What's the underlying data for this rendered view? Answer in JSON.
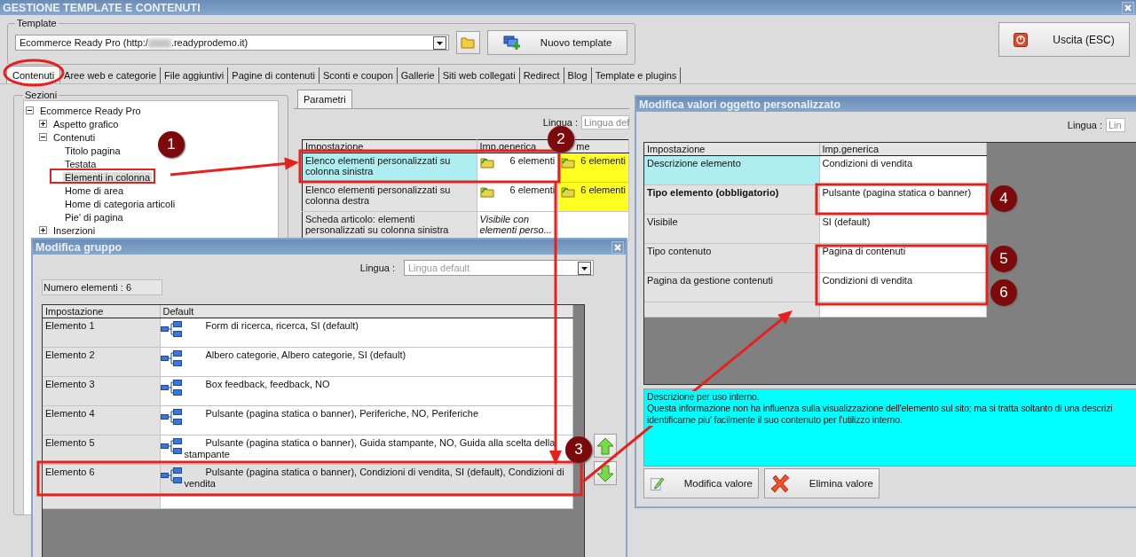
{
  "window": {
    "title": "GESTIONE TEMPLATE E CONTENUTI"
  },
  "template": {
    "label": "Template",
    "value_prefix": "Ecommerce Ready Pro (http:/",
    "value_suffix": ".readyprodemo.it)"
  },
  "buttons": {
    "new_template": "Nuovo template",
    "exit": "Uscita (ESC)"
  },
  "tabs": [
    {
      "label": "Contenuti",
      "selected": true
    },
    {
      "label": "Aree web e categorie",
      "selected": false
    },
    {
      "label": "File aggiuntivi",
      "selected": false
    },
    {
      "label": "Pagine di contenuti",
      "selected": false
    },
    {
      "label": "Sconti e coupon",
      "selected": false
    },
    {
      "label": "Gallerie",
      "selected": false
    },
    {
      "label": "Siti web collegati",
      "selected": false
    },
    {
      "label": "Redirect",
      "selected": false
    },
    {
      "label": "Blog",
      "selected": false
    },
    {
      "label": "Template e plugins",
      "selected": false
    }
  ],
  "sections": {
    "title": "Sezioni",
    "tree": [
      {
        "label": "Ecommerce Ready Pro",
        "expanded": true,
        "selected": false,
        "children": [
          {
            "label": "Aspetto grafico",
            "expanded": false,
            "selected": false
          },
          {
            "label": "Contenuti",
            "expanded": true,
            "selected": false,
            "children": [
              {
                "label": "Titolo pagina",
                "selected": false
              },
              {
                "label": "Testata",
                "selected": false
              },
              {
                "label": "Elementi in colonna",
                "selected": true
              },
              {
                "label": "Home di area",
                "selected": false
              },
              {
                "label": "Home di categoria articoli",
                "selected": false
              },
              {
                "label": "Pie' di pagina",
                "selected": false
              }
            ]
          },
          {
            "label": "Inserzioni",
            "expanded": false,
            "selected": false
          }
        ]
      }
    ]
  },
  "parameters": {
    "tab": "Parametri",
    "language_label": "Lingua :",
    "language_value": "Lingua def",
    "columns": [
      "Impostazione",
      "Imp.generica",
      "me"
    ],
    "rows": [
      {
        "setting": "Elenco elementi personalizzati su colonna sinistra",
        "kind": "group",
        "generic": "6 elementi",
        "column_3": "6 elementi",
        "column_3_set": true,
        "selected": true
      },
      {
        "setting": "Elenco elementi personalizzati su colonna destra",
        "kind": "group",
        "generic": "6 elementi",
        "column_3": "6 elementi",
        "column_3_set": true,
        "selected": false
      },
      {
        "setting": "Scheda articolo: elementi personalizzati su colonna sinistra",
        "kind": "text",
        "generic": "Visibile con elementi perso...",
        "column_3_set": false,
        "selected": false
      }
    ]
  },
  "group_dialog": {
    "title": "Modifica gruppo",
    "language_label": "Lingua :",
    "language_placeholder": "Lingua default",
    "count": "Numero elementi : 6",
    "columns": [
      "Impostazione",
      "Default"
    ],
    "rows": [
      {
        "name": "Elemento 1",
        "value": "Form di ricerca, ricerca, SI (default)",
        "selected": false
      },
      {
        "name": "Elemento 2",
        "value": "Albero categorie, Albero categorie, SI (default)",
        "selected": false
      },
      {
        "name": "Elemento 3",
        "value": "Box feedback, feedback, NO",
        "selected": false
      },
      {
        "name": "Elemento 4",
        "value": "Pulsante (pagina statica o banner), Periferiche, NO, Periferiche",
        "selected": false
      },
      {
        "name": "Elemento 5",
        "value": "Pulsante (pagina statica o banner), Guida stampante, NO, Guida alla scelta della stampante",
        "selected": false
      },
      {
        "name": "Elemento 6",
        "value": "Pulsante (pagina statica o banner), Condizioni di vendita, SI (default), Condizioni di vendita",
        "selected": true
      }
    ]
  },
  "value_dialog": {
    "title": "Modifica valori oggetto personalizzato",
    "language_label": "Lingua :",
    "language_value": "Lin",
    "columns": [
      "Impostazione",
      "Imp.generica"
    ],
    "rows": [
      {
        "setting": "Descrizione elemento",
        "value": "Condizioni di vendita",
        "required": false,
        "selected": true
      },
      {
        "setting": "Tipo elemento (obbligatorio)",
        "value": "Pulsante (pagina statica o banner)",
        "required": true,
        "selected": false
      },
      {
        "setting": "Visibile",
        "value": "SI (default)",
        "required": false,
        "selected": false
      },
      {
        "setting": "Tipo contenuto",
        "value": "Pagina di contenuti",
        "required": false,
        "selected": false
      },
      {
        "setting": "Pagina da gestione contenuti",
        "value": "Condizioni di vendita",
        "required": false,
        "selected": false
      }
    ],
    "description": [
      "Descrizione per uso interno.",
      "Questa informazione non ha influenza sulla visualizzazione dell'elemento sul sito; ma si tratta soltanto di una descrizi",
      "identificarne piu' facilmente il suo contenuto per l'utilizzo interno."
    ],
    "buttons": [
      {
        "label": "Modifica valore",
        "kind": "edit"
      },
      {
        "label": "Elimina valore",
        "kind": "delete"
      }
    ]
  },
  "annotations": [
    {
      "label": "1"
    },
    {
      "label": "2"
    },
    {
      "label": "3"
    },
    {
      "label": "4"
    },
    {
      "label": "5"
    },
    {
      "label": "6"
    }
  ]
}
